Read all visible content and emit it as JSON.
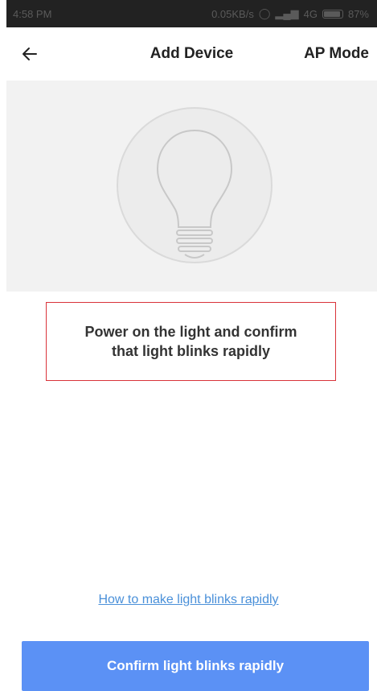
{
  "status_bar": {
    "time": "4:58 PM",
    "speed": "0.05KB/s",
    "network": "4G",
    "battery": "87%"
  },
  "header": {
    "title": "Add Device",
    "mode": "AP Mode"
  },
  "instruction": {
    "text": "Power on the light and confirm\nthat light blinks  rapidly"
  },
  "help": {
    "link": "How to make light blinks rapidly"
  },
  "actions": {
    "confirm": "Confirm light blinks rapidly"
  },
  "colors": {
    "primary": "#5b91f5",
    "link": "#4a90d9",
    "highlight_border": "#d9333a",
    "hero_bg": "#f2f2f2"
  },
  "icons": {
    "back": "back-arrow-icon",
    "hero": "light-bulb-icon"
  }
}
